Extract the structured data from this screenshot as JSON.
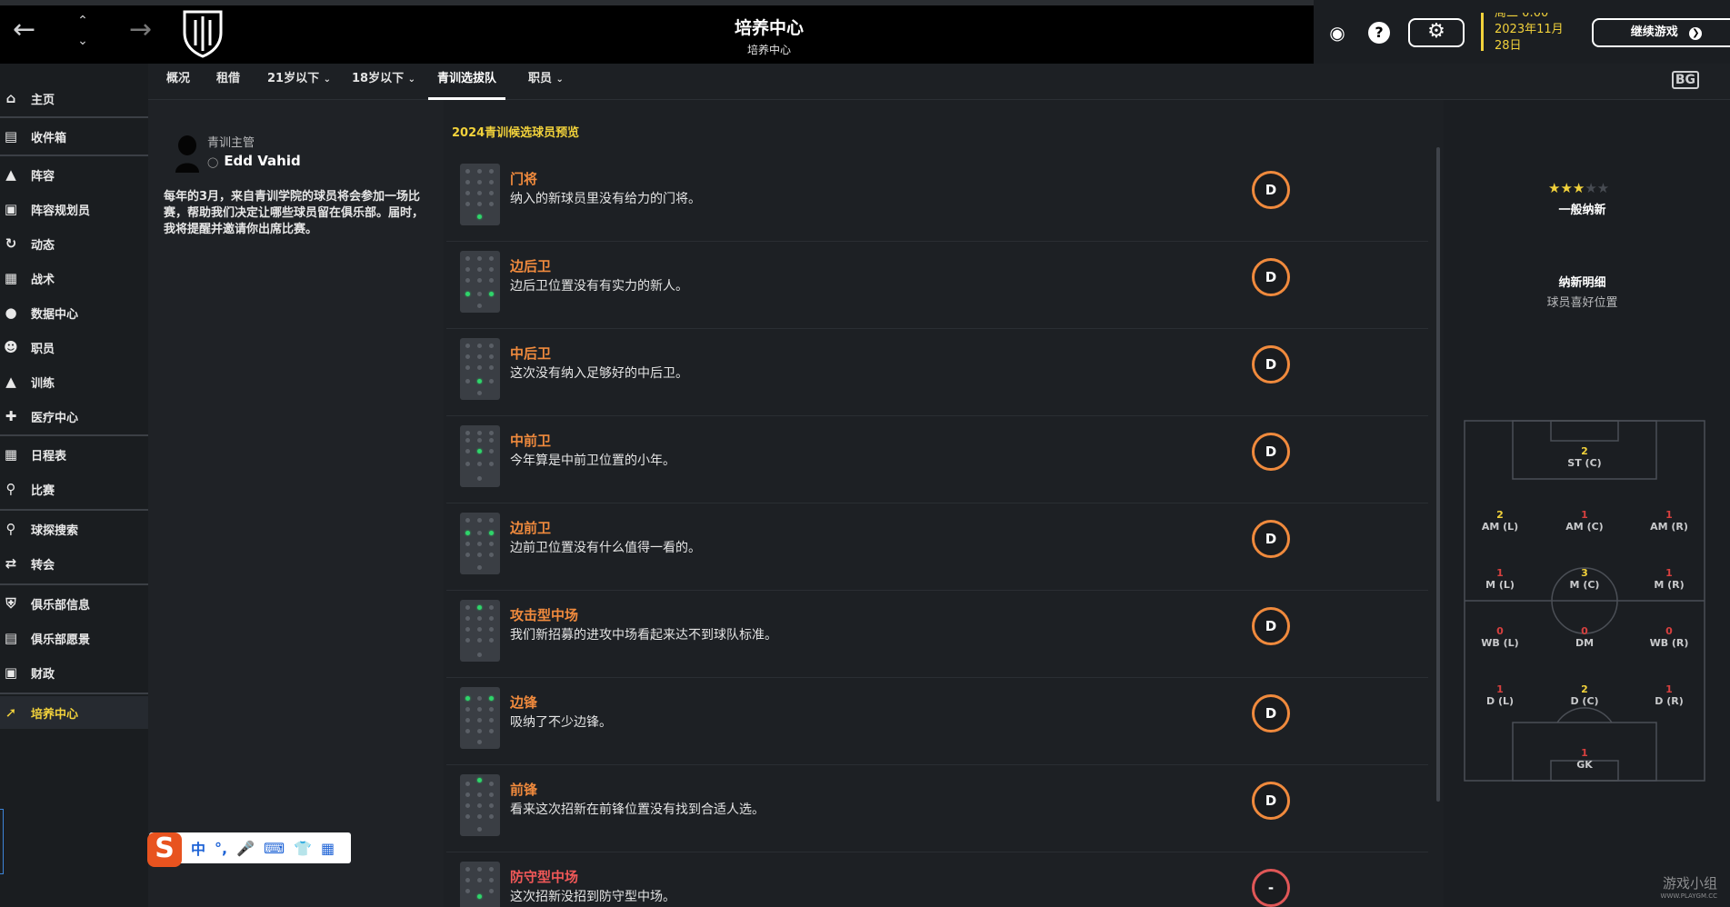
{
  "header": {
    "title": "培养中心",
    "subtitle": "培养中心",
    "date_line1": "周二 0:00",
    "date_line2": "2023年11月",
    "date_line3": "28日",
    "continue_label": "继续游戏",
    "help_label": "?"
  },
  "sidebar": {
    "items": [
      {
        "label": "主页",
        "icon": "home-icon"
      },
      {
        "label": "收件箱",
        "icon": "inbox-icon"
      },
      {
        "label": "阵容",
        "icon": "shirt-icon"
      },
      {
        "label": "阵容规划员",
        "icon": "clipboard-icon"
      },
      {
        "label": "动态",
        "icon": "dynamics-icon"
      },
      {
        "label": "战术",
        "icon": "tactics-icon"
      },
      {
        "label": "数据中心",
        "icon": "data-icon"
      },
      {
        "label": "职员",
        "icon": "staff-icon"
      },
      {
        "label": "训练",
        "icon": "training-icon"
      },
      {
        "label": "医疗中心",
        "icon": "medical-icon"
      },
      {
        "label": "日程表",
        "icon": "calendar-icon"
      },
      {
        "label": "比赛",
        "icon": "trophy-icon"
      },
      {
        "label": "球探搜索",
        "icon": "search-icon"
      },
      {
        "label": "转会",
        "icon": "transfer-icon"
      },
      {
        "label": "俱乐部信息",
        "icon": "shield-icon"
      },
      {
        "label": "俱乐部愿景",
        "icon": "vision-icon"
      },
      {
        "label": "财政",
        "icon": "finance-icon"
      },
      {
        "label": "培养中心",
        "icon": "development-icon"
      }
    ]
  },
  "tabs": [
    "概况",
    "租借",
    "21岁以下",
    "18岁以下",
    "青训选拔队",
    "职员"
  ],
  "active_tab": "青训选拔队",
  "bg_icon_label": "BG",
  "info": {
    "role": "青训主管",
    "name": "Edd Vahid",
    "description": "每年的3月，来自青训学院的球员将会参加一场比赛，帮助我们决定让哪些球员留在俱乐部。届时，我将提醒并邀请你出席比赛。"
  },
  "ime": {
    "logo": "S",
    "label_zh": "中",
    "punct": "°,"
  },
  "list": {
    "heading": "2024青训候选球员预览",
    "rows": [
      {
        "name": "门将",
        "desc": "纳入的新球员里没有给力的门将。",
        "grade": "D"
      },
      {
        "name": "边后卫",
        "desc": "边后卫位置没有有实力的新人。",
        "grade": "D"
      },
      {
        "name": "中后卫",
        "desc": "这次没有纳入足够好的中后卫。",
        "grade": "D"
      },
      {
        "name": "中前卫",
        "desc": "今年算是中前卫位置的小年。",
        "grade": "D"
      },
      {
        "name": "边前卫",
        "desc": "边前卫位置没有什么值得一看的。",
        "grade": "D"
      },
      {
        "name": "攻击型中场",
        "desc": "我们新招募的进攻中场看起来达不到球队标准。",
        "grade": "D"
      },
      {
        "name": "边锋",
        "desc": "吸纳了不少边锋。",
        "grade": "D"
      },
      {
        "name": "前锋",
        "desc": "看来这次招新在前锋位置没有找到合适人选。",
        "grade": "D"
      },
      {
        "name": "防守型中场",
        "desc": "这次招新没招到防守型中场。",
        "grade": "-"
      }
    ]
  },
  "right": {
    "rating_stars": 3,
    "rating_label": "一般纳新",
    "detail_title": "纳新明细",
    "detail_sub": "球员喜好位置",
    "positions": {
      "st": {
        "label": "ST (C)",
        "n": "2"
      },
      "aml": {
        "label": "AM (L)",
        "n": "2"
      },
      "amc": {
        "label": "AM (C)",
        "n": "1"
      },
      "amr": {
        "label": "AM (R)",
        "n": "1"
      },
      "ml": {
        "label": "M (L)",
        "n": "1"
      },
      "mc": {
        "label": "M (C)",
        "n": "3"
      },
      "mr": {
        "label": "M (R)",
        "n": "1"
      },
      "wbl": {
        "label": "WB (L)",
        "n": "0"
      },
      "dm": {
        "label": "DM",
        "n": "0"
      },
      "wbr": {
        "label": "WB (R)",
        "n": "0"
      },
      "dl": {
        "label": "D (L)",
        "n": "1"
      },
      "dc": {
        "label": "D (C)",
        "n": "2"
      },
      "dr": {
        "label": "D (R)",
        "n": "1"
      },
      "gk": {
        "label": "GK",
        "n": "1"
      }
    }
  },
  "watermark": {
    "text": "游戏小组",
    "url": "WWW.PLAYGM.CC"
  },
  "colors": {
    "accent_yellow": "#f2d23b",
    "position_orange": "#f08a3d",
    "alert_red": "#e05757",
    "mini_dot_green": "#2fd56a"
  }
}
